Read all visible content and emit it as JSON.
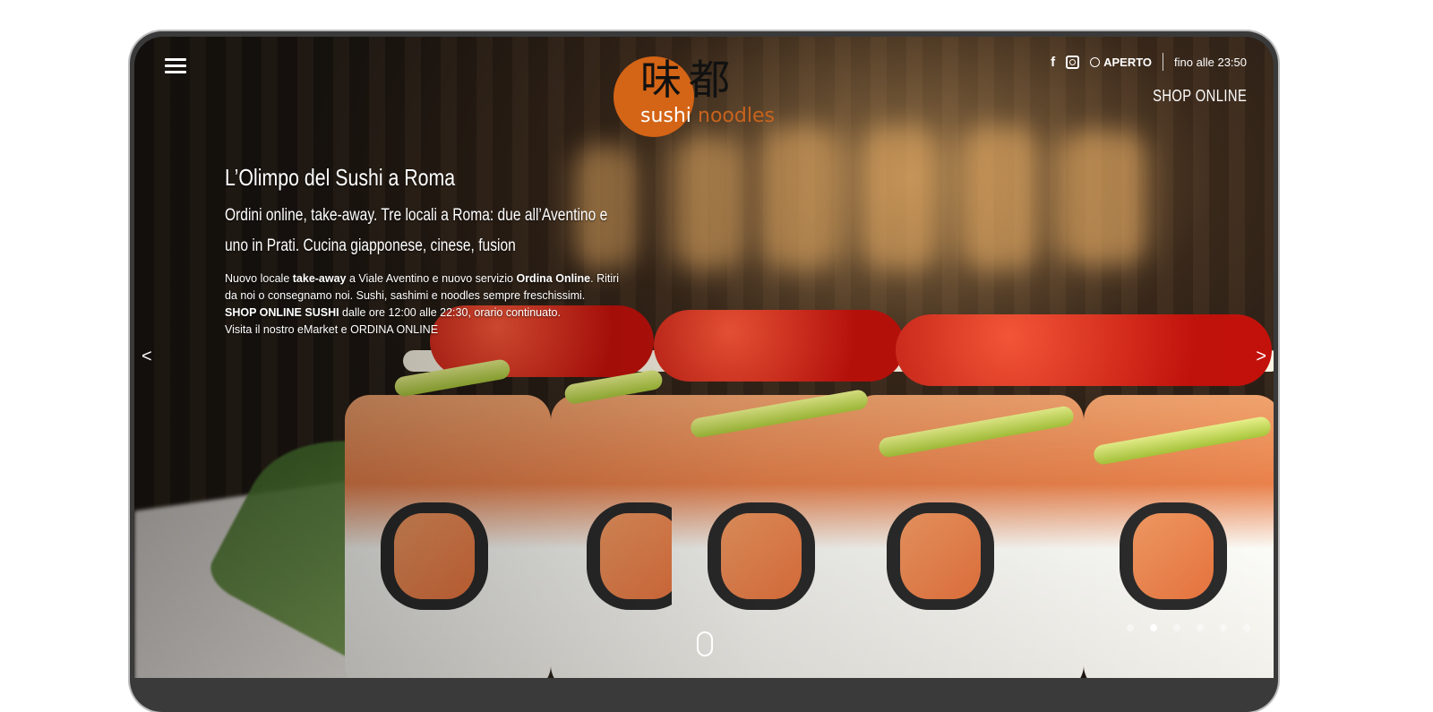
{
  "header": {
    "logo_kanji": "味都",
    "logo_sushi": "sushi",
    "logo_noodles": "noodles",
    "facebook_icon": "facebook-icon",
    "instagram_icon": "instagram-icon",
    "clock_icon": "clock-icon",
    "status_label": "APERTO",
    "status_until": "fino alle 23:50",
    "shop_online": "SHOP ONLINE"
  },
  "hero": {
    "title": "L’Olimpo del Sushi a Roma",
    "subtitle": "Ordini online, take-away.  Tre locali a Roma: due all’Aventino e uno in Prati. Cucina giapponese, cinese, fusion",
    "body": {
      "line1_pre": "Nuovo locale ",
      "line1_bold1": "take-away",
      "line1_mid": " a Viale Aventino e nuovo servizio ",
      "line1_bold2": "Ordina Online",
      "line1_post": ". Ritiri da noi o consegnamo noi. Sushi, sashimi e noodles sempre freschissimi.",
      "line2_bold": "SHOP ONLINE SUSHI",
      "line2_post": " dalle ore 12:00 alle 22:30, orario continuato.",
      "line3": "Visita il nostro eMarket e ORDINA ONLINE"
    }
  },
  "slider": {
    "prev_label": "<",
    "next_label": ">",
    "active_index": 1,
    "dot_count": 6
  },
  "colors": {
    "brand_orange": "#d46416",
    "text": "#ffffff"
  }
}
